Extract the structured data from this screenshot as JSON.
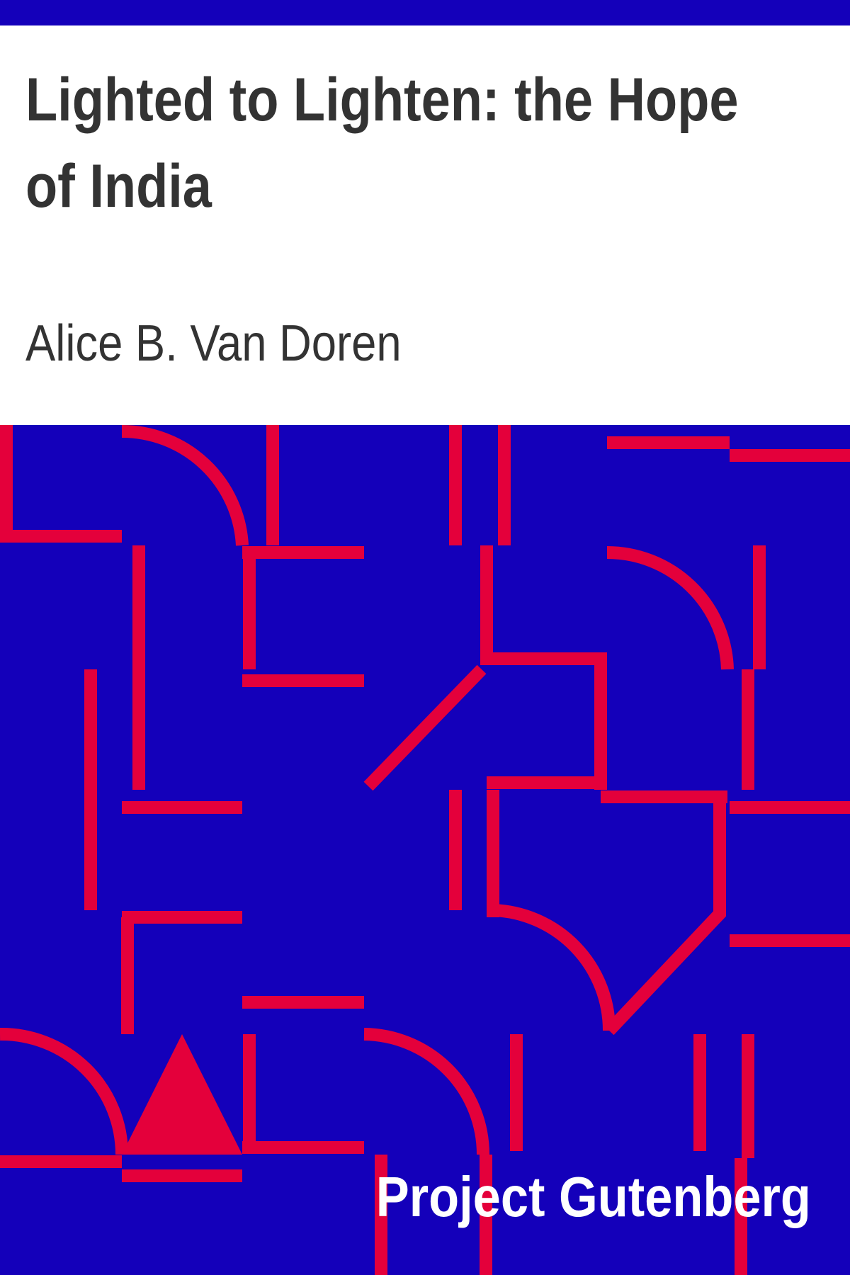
{
  "cover": {
    "title": "Lighted to Lighten: the Hope of India",
    "author": "Alice B. Van Doren",
    "publisher": "Project Gutenberg"
  },
  "colors": {
    "background_blue": "#1400ba",
    "pattern_red": "#e4003b",
    "header_white": "#ffffff",
    "text_dark": "#333333",
    "brand_text": "#ffffff"
  }
}
